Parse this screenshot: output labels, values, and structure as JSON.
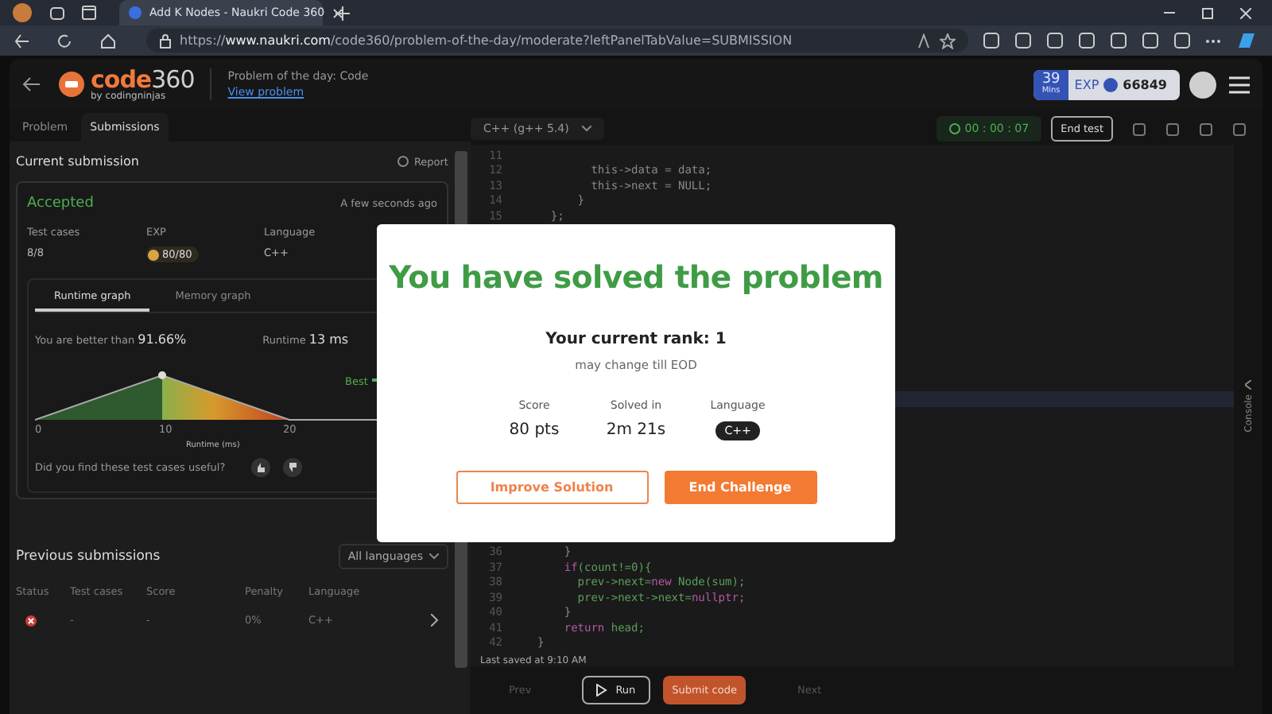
{
  "browser": {
    "tab_title": "Add K Nodes - Naukri Code 360",
    "url_scheme": "https://",
    "url_host": "www.naukri.com",
    "url_path": "/code360/problem-of-the-day/moderate?leftPanelTabValue=SUBMISSION"
  },
  "header": {
    "logo_main": "code",
    "logo_num": "360",
    "logo_sub": "by codingninjas",
    "problem_label": "Problem of the day: Code",
    "view_link": "View problem",
    "time_value": "39",
    "time_unit": "Mins",
    "exp_label": "EXP",
    "exp_value": "66849"
  },
  "left_tabs": [
    {
      "label": "Problem",
      "selected": false
    },
    {
      "label": "Submissions",
      "selected": true
    }
  ],
  "current_submission": {
    "title": "Current submission",
    "report": "Report",
    "verdict": "Accepted",
    "time_ago": "A few seconds ago",
    "stats": [
      {
        "label": "Test cases",
        "value": "8/8",
        "kind": "text"
      },
      {
        "label": "EXP",
        "value": "80/80",
        "kind": "coin"
      },
      {
        "label": "Language",
        "value": "C++",
        "kind": "text"
      }
    ],
    "graph_tabs": [
      {
        "label": "Runtime graph",
        "selected": true
      },
      {
        "label": "Memory graph",
        "selected": false
      }
    ],
    "better_label": "You are better than",
    "better_value": "91.66%",
    "runtime_label": "Runtime",
    "runtime_value": "13 ms",
    "best_label": "Best",
    "graph_ticks": [
      "0",
      "10",
      "20"
    ],
    "graph_xlabel": "Runtime (ms)",
    "feedback_question": "Did you find these test cases useful?"
  },
  "previous_submissions": {
    "title": "Previous submissions",
    "filter": "All languages",
    "columns": [
      "Status",
      "Test cases",
      "Score",
      "Penalty",
      "Language"
    ],
    "rows": [
      {
        "failed": true,
        "test_cases": "-",
        "score": "-",
        "penalty": "0%",
        "language": "C++"
      }
    ]
  },
  "editor": {
    "language": "C++ (g++ 5.4)",
    "timer": "00 : 00 : 07",
    "end_test": "End test",
    "lines_top": [
      {
        "number": "11"
      },
      {
        "number": "12",
        "tokens": [
          {
            "text": "        this->data = data;",
            "kind": "plain"
          }
        ]
      },
      {
        "number": "13",
        "tokens": [
          {
            "text": "        this->next = NULL;",
            "kind": "plain"
          }
        ]
      },
      {
        "number": "14",
        "tokens": [
          {
            "text": "      }",
            "kind": "plain"
          }
        ]
      },
      {
        "number": "15",
        "tokens": [
          {
            "text": "  };",
            "kind": "plain"
          }
        ]
      }
    ],
    "lines_bottom": [
      {
        "number": "36",
        "tokens": [
          {
            "text": "    }",
            "kind": "plain"
          }
        ]
      },
      {
        "number": "37",
        "tokens": [
          {
            "text": "    if",
            "kind": "keyword"
          },
          {
            "text": "(count!=0){",
            "kind": "ident"
          }
        ]
      },
      {
        "number": "38",
        "tokens": [
          {
            "text": "      prev->next=",
            "kind": "ident"
          },
          {
            "text": "new",
            "kind": "keyword"
          },
          {
            "text": " Node(sum);",
            "kind": "ident"
          }
        ]
      },
      {
        "number": "39",
        "tokens": [
          {
            "text": "      prev->next->next=",
            "kind": "ident"
          },
          {
            "text": "nullptr;",
            "kind": "keyword"
          }
        ]
      },
      {
        "number": "40",
        "tokens": [
          {
            "text": "    }",
            "kind": "plain"
          }
        ]
      },
      {
        "number": "41",
        "tokens": [
          {
            "text": "    return",
            "kind": "keyword"
          },
          {
            "text": " head;",
            "kind": "ident"
          }
        ]
      },
      {
        "number": "42",
        "tokens": [
          {
            "text": "}",
            "kind": "plain"
          }
        ]
      }
    ],
    "last_saved": "Last saved at 9:10 AM",
    "prev": "Prev",
    "run": "Run",
    "submit": "Submit code",
    "next": "Next",
    "console": "Console"
  },
  "modal": {
    "title": "You have solved the problem",
    "rank": "Your current rank: 1",
    "rank_note": "may change till EOD",
    "stats": [
      {
        "label": "Score",
        "value": "80 pts",
        "kind": "text"
      },
      {
        "label": "Solved in",
        "value": "2m 21s",
        "kind": "text"
      },
      {
        "label": "Language",
        "value": "C++",
        "kind": "pill"
      }
    ],
    "improve_button": "Improve Solution",
    "end_button": "End Challenge"
  }
}
